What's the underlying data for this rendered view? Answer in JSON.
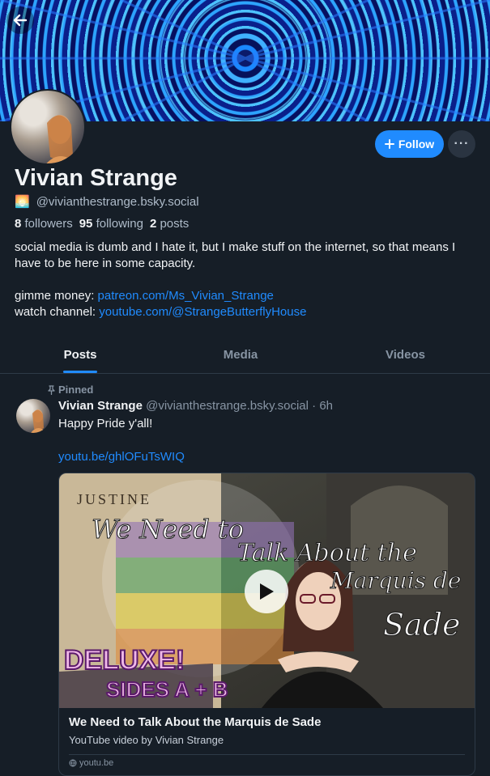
{
  "profile": {
    "display_name": "Vivian Strange",
    "handle_emoji": "🌅",
    "handle": "@vivianthestrange.bsky.social",
    "followers_count": "8",
    "followers_label": "followers",
    "following_count": "95",
    "following_label": "following",
    "posts_count": "2",
    "posts_label": "posts",
    "bio_line1": "social media is dumb and I hate it, but I make stuff on the internet, so that means I have to be here in some capacity.",
    "money_label": "gimme money: ",
    "money_link": "patreon.com/Ms_Vivian_Strange",
    "channel_label": "watch channel: ",
    "channel_link": "youtube.com/@StrangeButterflyHouse"
  },
  "actions": {
    "follow_label": "Follow",
    "more_label": "···"
  },
  "tabs": [
    {
      "label": "Posts",
      "active": true
    },
    {
      "label": "Media",
      "active": false
    },
    {
      "label": "Videos",
      "active": false
    }
  ],
  "post": {
    "pinned_label": "Pinned",
    "author_name": "Vivian Strange",
    "author_handle": "@vivianthestrange.bsky.social",
    "separator": " · ",
    "time": "6h",
    "text": "Happy Pride y'all!",
    "link": "youtu.be/ghlOFuTsWIQ",
    "embed": {
      "title": "We Need to Talk About the Marquis de Sade",
      "description": "YouTube video by Vivian Strange",
      "domain": "youtu.be",
      "thumb_book_title": "JUSTINE",
      "thumb_script_1": "We Need to",
      "thumb_script_2": "Talk About the",
      "thumb_script_3": "Marquis de",
      "thumb_script_4": "Sade",
      "thumb_badge_1": "DELUXE!",
      "thumb_badge_2": "SIDES A + B"
    }
  },
  "colors": {
    "background": "#161e27",
    "accent": "#208bfe",
    "muted_text": "#8794a3"
  }
}
